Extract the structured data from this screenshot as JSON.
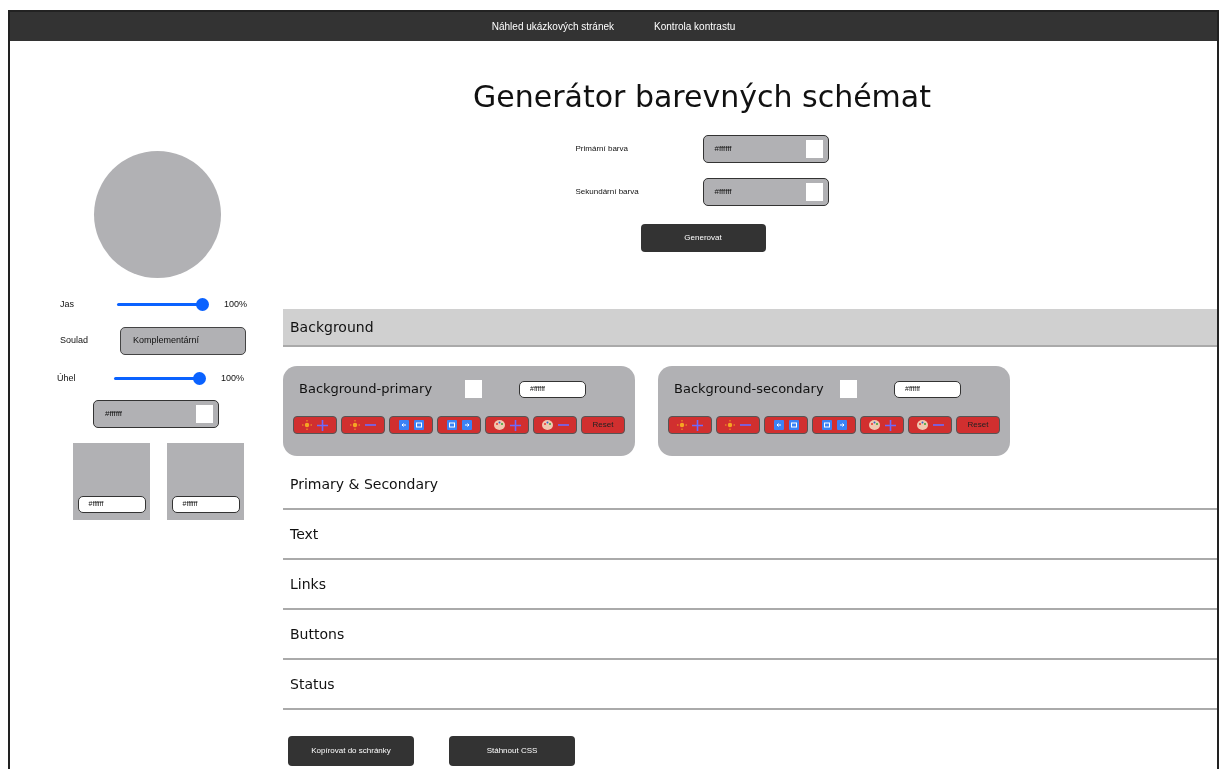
{
  "nav": {
    "links": [
      "Náhled ukázkových stránek",
      "Kontrola kontrastu"
    ]
  },
  "title": "Generátor barevných schémat",
  "color_inputs": [
    {
      "label": "Primární barva",
      "value": "#ffffff"
    },
    {
      "label": "Sekundární barva",
      "value": "#ffffff"
    }
  ],
  "generate_button": "Generovat",
  "sidebar": {
    "sliders": [
      {
        "label": "Jas",
        "level": 1,
        "reading": "100%"
      },
      {
        "label": "Úhel",
        "level": 1,
        "reading": "100%"
      }
    ],
    "harmony": {
      "label": "Soulad",
      "value": "Komplementární"
    },
    "color_value": "#ffffff",
    "swatches": [
      {
        "value": "#ffffff"
      },
      {
        "value": "#ffffff"
      }
    ]
  },
  "sections": [
    {
      "title": "Background",
      "expanded": true,
      "cards": [
        {
          "title": "Background-primary",
          "value": "#ffffff",
          "buttons": [
            {
              "kind": "lighten"
            },
            {
              "kind": "darken"
            },
            {
              "kind": "shift-left"
            },
            {
              "kind": "shift-right"
            },
            {
              "kind": "saturate"
            },
            {
              "kind": "desaturate"
            },
            {
              "kind": "reset",
              "label": "Reset"
            }
          ]
        },
        {
          "title": "Background-secondary",
          "value": "#ffffff",
          "buttons": [
            {
              "kind": "lighten"
            },
            {
              "kind": "darken"
            },
            {
              "kind": "shift-left"
            },
            {
              "kind": "shift-right"
            },
            {
              "kind": "saturate"
            },
            {
              "kind": "desaturate"
            },
            {
              "kind": "reset",
              "label": "Reset"
            }
          ]
        }
      ]
    },
    {
      "title": "Primary & Secondary",
      "expanded": false
    },
    {
      "title": "Text",
      "expanded": false
    },
    {
      "title": "Links",
      "expanded": false
    },
    {
      "title": "Buttons",
      "expanded": false
    },
    {
      "title": "Status",
      "expanded": false
    }
  ],
  "footer_buttons": [
    "Kopírovat do schránky",
    "Stáhnout CSS"
  ]
}
